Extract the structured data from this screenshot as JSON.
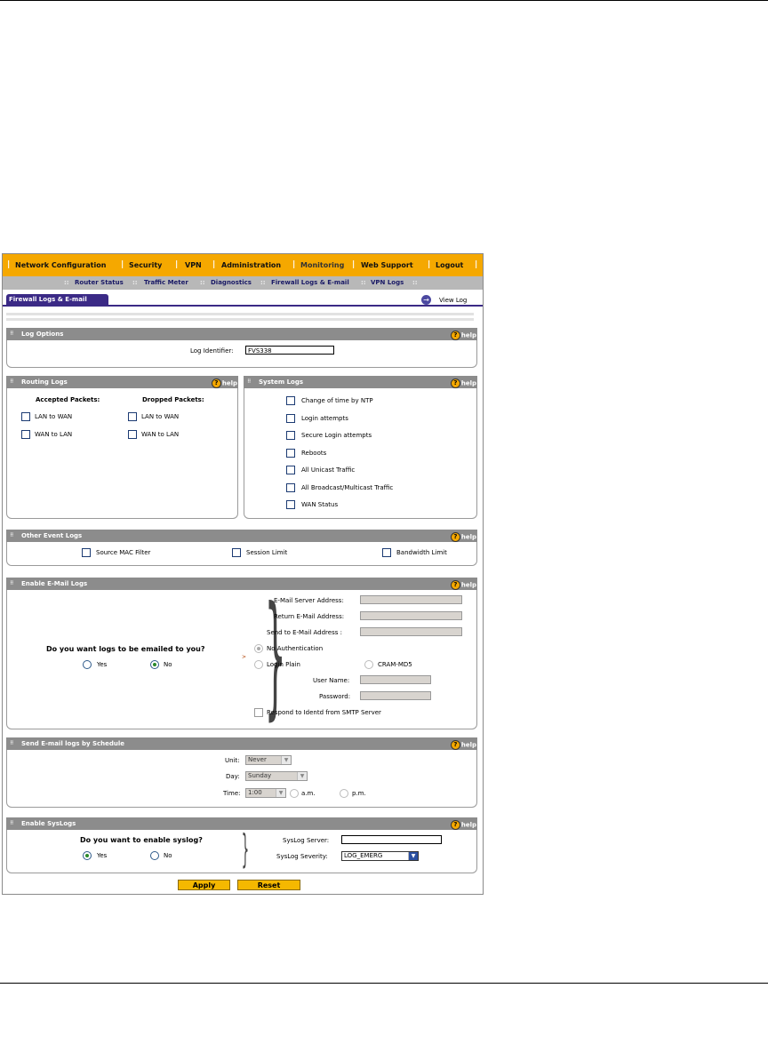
{
  "nav": {
    "items": [
      "Network Configuration",
      "Security",
      "VPN",
      "Administration",
      "Monitoring",
      "Web Support",
      "Logout"
    ],
    "separator": "|"
  },
  "subnav": {
    "items": [
      "Router Status",
      "Traffic Meter",
      "Diagnostics",
      "Firewall Logs & E-mail",
      "VPN Logs"
    ],
    "separator": "::"
  },
  "tab": {
    "active": "Firewall Logs & E-mail",
    "view_log": "View Log",
    "view_log_icon": "arrow-right-circle-icon"
  },
  "help_label": "help",
  "help_icon": "?",
  "log_options": {
    "title": "Log Options",
    "identifier_label": "Log Identifier:",
    "identifier_value": "FVS338"
  },
  "routing_logs": {
    "title": "Routing Logs",
    "accepted_header": "Accepted Packets:",
    "dropped_header": "Dropped Packets:",
    "accepted": [
      "LAN to WAN",
      "WAN to LAN"
    ],
    "dropped": [
      "LAN to WAN",
      "WAN to LAN"
    ]
  },
  "system_logs": {
    "title": "System Logs",
    "items": [
      "Change of time by NTP",
      "Login attempts",
      "Secure Login attempts",
      "Reboots",
      "All Unicast Traffic",
      "All Broadcast/Multicast Traffic",
      "WAN Status"
    ]
  },
  "other_event_logs": {
    "title": "Other Event Logs",
    "items": [
      "Source MAC Filter",
      "Session Limit",
      "Bandwidth Limit"
    ]
  },
  "email_logs": {
    "title": "Enable E-Mail Logs",
    "question": "Do you want logs to be emailed to you?",
    "yes": "Yes",
    "no": "No",
    "selected": "No",
    "server_label": "E-Mail Server Address:",
    "return_label": "Return E-Mail Address:",
    "send_label": "Send to E-Mail Address :",
    "no_auth": "No Authentication",
    "login_plain": "Login Plain",
    "cram": "CRAM-MD5",
    "username_label": "User Name:",
    "password_label": "Password:",
    "identd": "Respond to Identd from SMTP Server"
  },
  "schedule": {
    "title": "Send E-mail logs by Schedule",
    "unit_label": "Unit:",
    "unit_value": "Never",
    "day_label": "Day:",
    "day_value": "Sunday",
    "time_label": "Time:",
    "time_value": "1:00",
    "am": "a.m.",
    "pm": "p.m."
  },
  "syslog": {
    "title": "Enable SysLogs",
    "question": "Do you want to enable syslog?",
    "yes": "Yes",
    "no": "No",
    "selected": "Yes",
    "server_label": "SysLog Server:",
    "severity_label": "SysLog Severity:",
    "severity_value": "LOG_EMERG"
  },
  "buttons": {
    "apply": "Apply",
    "reset": "Reset"
  },
  "colors": {
    "nav_bg": "#f5a800",
    "tab_active": "#3b2a86",
    "section_header": "#8c8c8c",
    "button": "#f5b800"
  }
}
